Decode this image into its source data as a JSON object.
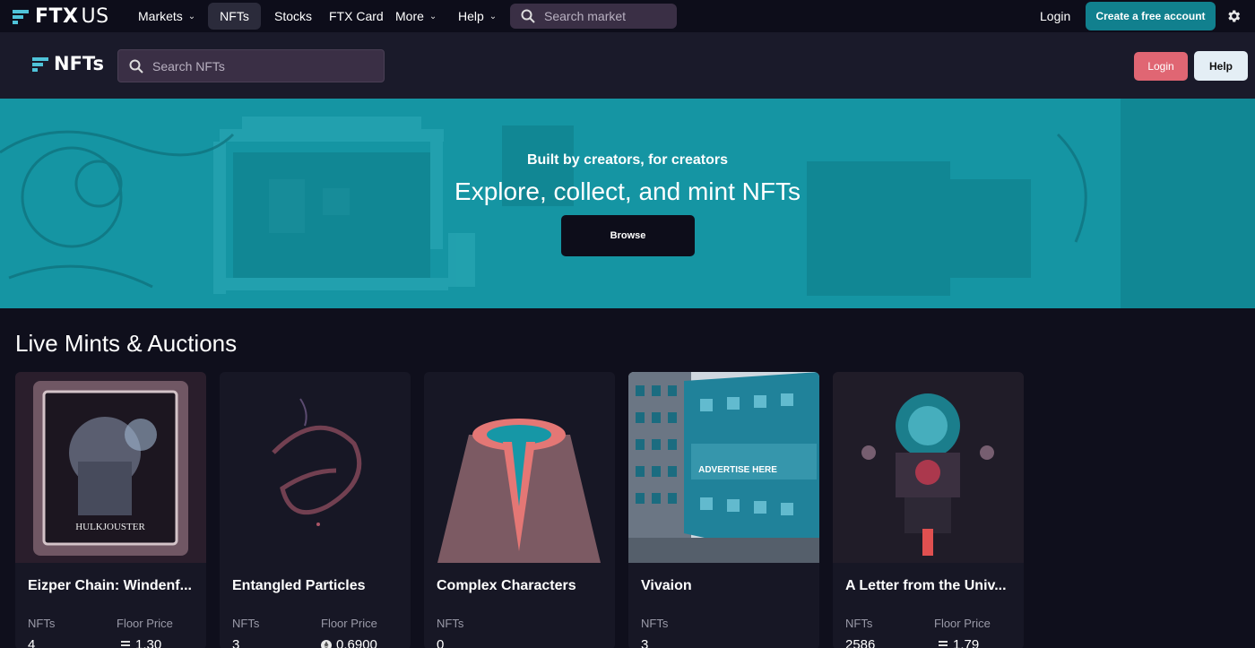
{
  "topnav": {
    "logo_text": "FTX",
    "logo_suffix": "US",
    "items": [
      {
        "label": "Markets",
        "has_dropdown": true
      },
      {
        "label": "NFTs",
        "active": true
      },
      {
        "label": "Stocks"
      },
      {
        "label": "FTX Card"
      },
      {
        "label": "More",
        "has_dropdown": true
      },
      {
        "label": "Help",
        "has_dropdown": true
      }
    ],
    "search_placeholder": "Search market",
    "login_label": "Login",
    "create_account_label": "Create a free account",
    "settings_icon": "gear-icon"
  },
  "nft_header": {
    "logo_text": "NFTs",
    "search_placeholder": "Search NFTs",
    "login_label": "Login",
    "help_label": "Help"
  },
  "hero": {
    "subtitle": "Built by creators, for creators",
    "title": "Explore, collect, and mint NFTs",
    "button_label": "Browse"
  },
  "section": {
    "title": "Live Mints & Auctions",
    "cards": [
      {
        "name": "Eizper Chain: Windenf...",
        "nfts_label": "NFTs",
        "nfts": "4",
        "floor_label": "Floor Price",
        "floor": "1.30",
        "coin": "sol"
      },
      {
        "name": "Entangled Particles",
        "nfts_label": "NFTs",
        "nfts": "3",
        "floor_label": "Floor Price",
        "floor": "0.6900",
        "coin": "eth"
      },
      {
        "name": "Complex Characters",
        "nfts_label": "NFTs",
        "nfts": "0"
      },
      {
        "name": "Vivaion",
        "nfts_label": "NFTs",
        "nfts": "3"
      },
      {
        "name": "A Letter from the Univ...",
        "nfts_label": "NFTs",
        "nfts": "2586",
        "floor_label": "Floor Price",
        "floor": "1.79",
        "coin": "sol"
      }
    ],
    "card_art_text": [
      "HULKJOUSTER",
      "ADVERTISE HERE"
    ]
  },
  "colors": {
    "accent": "#11808e",
    "hero_bg": "#1595a3",
    "login_pink": "#e06673",
    "page_bg": "#0f0f1c"
  }
}
